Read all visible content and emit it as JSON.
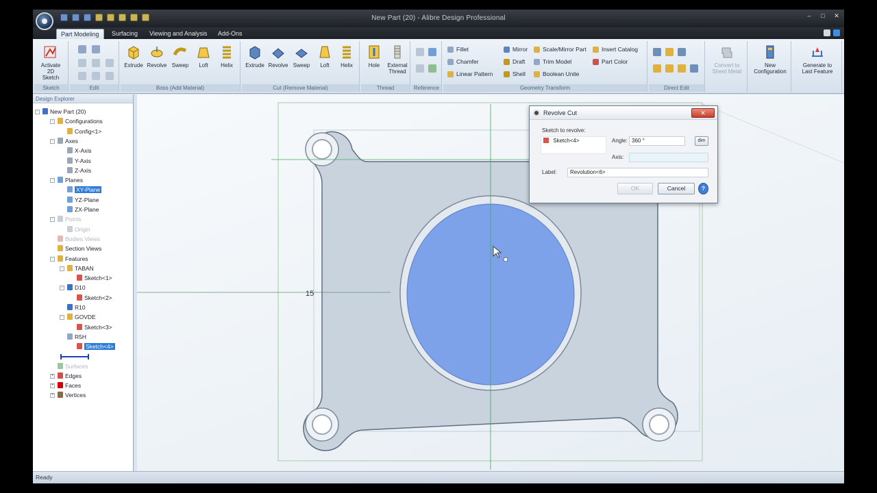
{
  "window": {
    "title": "New Part (20) - Alibre Design Professional"
  },
  "ribbon_tabs": [
    "Part Modeling",
    "Surfacing",
    "Viewing and Analysis",
    "Add-Ons"
  ],
  "ribbon": {
    "activate_sketch": "Activate\n2D Sketch",
    "boss": [
      "Extrude",
      "Revolve",
      "Sweep",
      "Loft",
      "Helix"
    ],
    "cut": [
      "Extrude",
      "Revolve",
      "Sweep",
      "Loft",
      "Helix"
    ],
    "thread": [
      "Hole",
      "External\nThread"
    ],
    "geometry": {
      "fillet": "Fillet",
      "chamfer": "Chamfer",
      "linear_pattern": "Linear Pattern",
      "mirror": "Mirror",
      "draft": "Draft",
      "shell": "Shell",
      "scale_mirror": "Scale/Mirror Part",
      "trim_model": "Trim Model",
      "boolean_unite": "Boolean Unite",
      "insert_catalog": "Insert Catalog",
      "part_color": "Part Color"
    },
    "convert_sheet_metal": "Convert to\nSheet Metal",
    "new_configuration": "New\nConfiguration",
    "generate_last_feature": "Generate to\nLast Feature",
    "group_labels": [
      "Sketch",
      "Edit",
      "Boss (Add Material)",
      "Cut (Remove Material)",
      "Thread",
      "Reference",
      "Geometry Transform",
      "Direct Edit"
    ]
  },
  "explorer": {
    "title": "Design Explorer",
    "items": [
      "New Part (20)",
      "Configurations",
      "Config<1>",
      "Axes",
      "X-Axis",
      "Y-Axis",
      "Z-Axis",
      "Planes",
      "XY-Plane",
      "YZ-Plane",
      "ZX-Plane",
      "Points",
      "Origin",
      "Bodies Views",
      "Section Views",
      "Features",
      "TABAN",
      "Sketch<1>",
      "D10",
      "Sketch<2>",
      "R10",
      "GOVDE",
      "Sketch<3>",
      "R5H",
      "Sketch<4>",
      "Surfaces",
      "Edges",
      "Faces",
      "Vertices"
    ]
  },
  "viewport": {
    "dimension_label": "15"
  },
  "dialog": {
    "title": "Revolve Cut",
    "close": "✕",
    "sketch_to_revolve_label": "Sketch to revolve:",
    "sketch_value": "Sketch<4>",
    "angle_label": "Angle:",
    "angle_value": "360 °",
    "angle_unit": "dim",
    "axis_label": "Axis:",
    "axis_value": "",
    "label_label": "Label:",
    "label_value": "Revolution<6>",
    "ok": "OK",
    "cancel": "Cancel",
    "help": "?"
  },
  "status": "Ready"
}
